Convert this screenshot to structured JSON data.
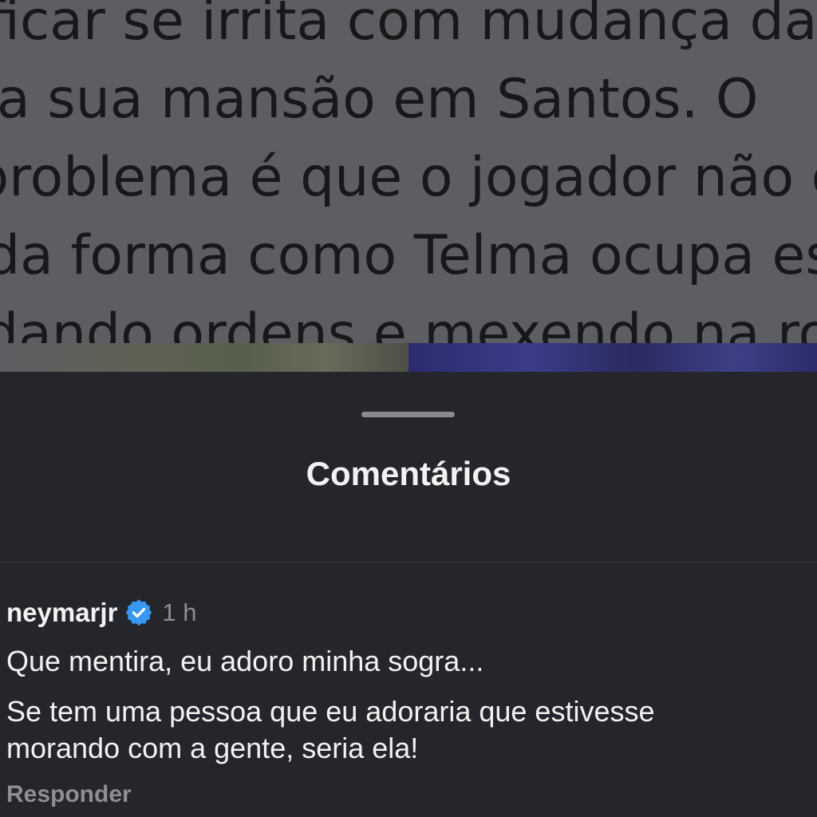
{
  "post": {
    "lines": [
      "ficar se irrita com mudança da sogra",
      "a sua mansão em Santos. O",
      "problema é que o jogador não gosta",
      "da forma como Telma ocupa espaços,",
      "dando ordens e mexendo na rotina"
    ]
  },
  "sheet": {
    "title": "Comentários"
  },
  "comment": {
    "username": "neymarjr",
    "verified_icon": "verified-badge-icon",
    "verified_color": "#3897f0",
    "timestamp": "1 h",
    "lines": [
      "Que mentira, eu adoro minha sogra...",
      "Se tem uma pessoa que eu adoraria que estivesse",
      "morando com a gente, seria ela!"
    ],
    "reply_label": "Responder"
  }
}
